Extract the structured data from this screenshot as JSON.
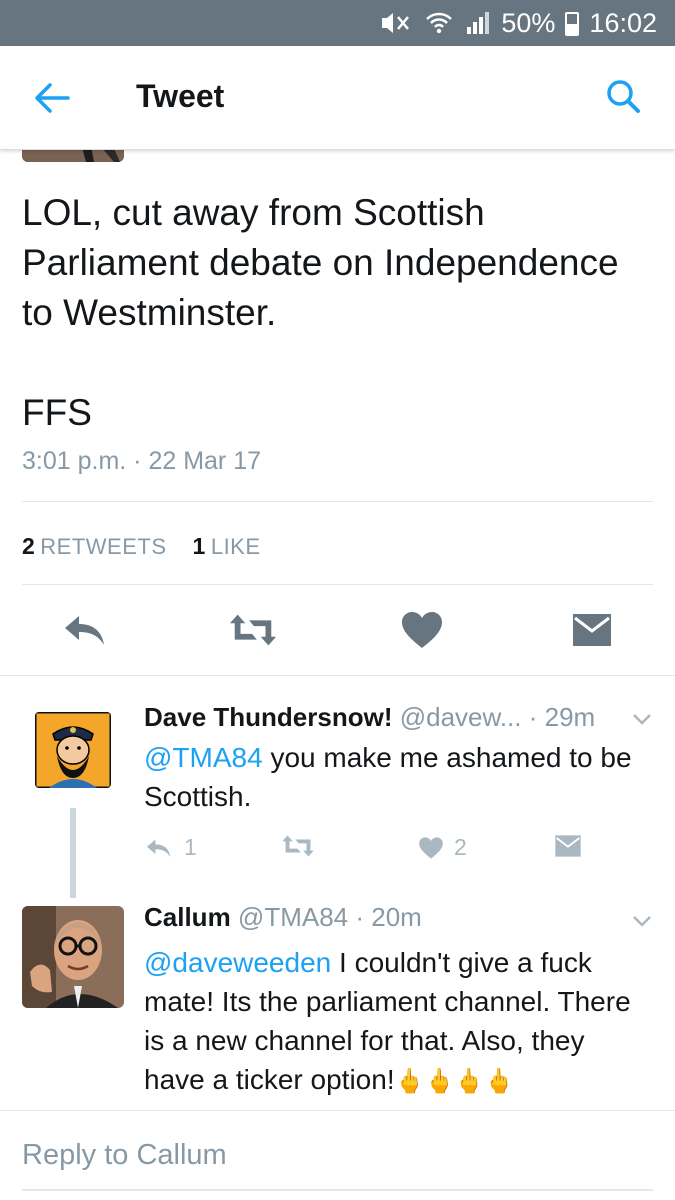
{
  "status_bar": {
    "battery": "50%",
    "time": "16:02",
    "battery_level": 0.5,
    "icons": [
      "mute-icon",
      "wifi-icon",
      "signal-icon",
      "battery-icon"
    ]
  },
  "header": {
    "title": "Tweet",
    "back_icon": "arrow-left-icon",
    "search_icon": "search-icon"
  },
  "tweet": {
    "text": "LOL, cut away from Scottish Parliament debate on Independence to Westminster.\n\nFFS",
    "timestamp": "3:01 p.m. · 22 Mar 17",
    "retweets_count": "2",
    "retweets_label": "RETWEETS",
    "likes_count": "1",
    "likes_label": "LIKE",
    "actions": [
      "reply-icon",
      "retweet-icon",
      "heart-icon",
      "envelope-icon"
    ]
  },
  "replies": [
    {
      "name": "Dave Thundersnow!",
      "handle": "@davew...",
      "time": "· 29m",
      "mention": "@TMA84",
      "text": " you make me ashamed to be Scottish.",
      "reply_count": "1",
      "like_count": "2"
    },
    {
      "name": "Callum",
      "handle": "@TMA84",
      "time": "· 20m",
      "mention": "@daveweeden",
      "text": " I couldn't give a fuck mate! Its the parliament channel. There is a new channel for that. Also, they have a ticker option!",
      "emoji": "🖕🖕🖕🖕"
    }
  ],
  "reply_bar": {
    "placeholder": "Reply to Callum"
  },
  "colors": {
    "accent": "#1da1f2",
    "status_bar": "#66757f",
    "icon_gray": "#66757f",
    "muted": "#8899a6"
  }
}
